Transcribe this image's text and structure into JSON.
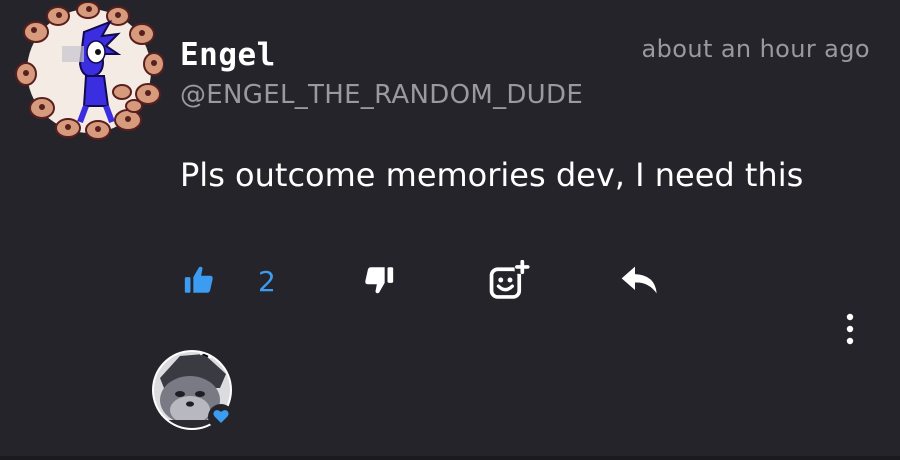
{
  "comment": {
    "username": "Engel",
    "handle": "@ENGEL_THE_RANDOM_DUDE",
    "timestamp": "about an hour ago",
    "text": "Pls outcome memories dev, I need this",
    "like_count": "2",
    "liked": true
  },
  "icons": {
    "like": "thumbs-up-icon",
    "dislike": "thumbs-down-icon",
    "react": "add-reaction-icon",
    "reply": "reply-icon",
    "more": "more-vertical-icon",
    "heart": "heart-icon"
  },
  "colors": {
    "background": "#26242b",
    "accent": "#3b9cf2",
    "text": "#ffffff",
    "muted": "#9a99a0"
  }
}
